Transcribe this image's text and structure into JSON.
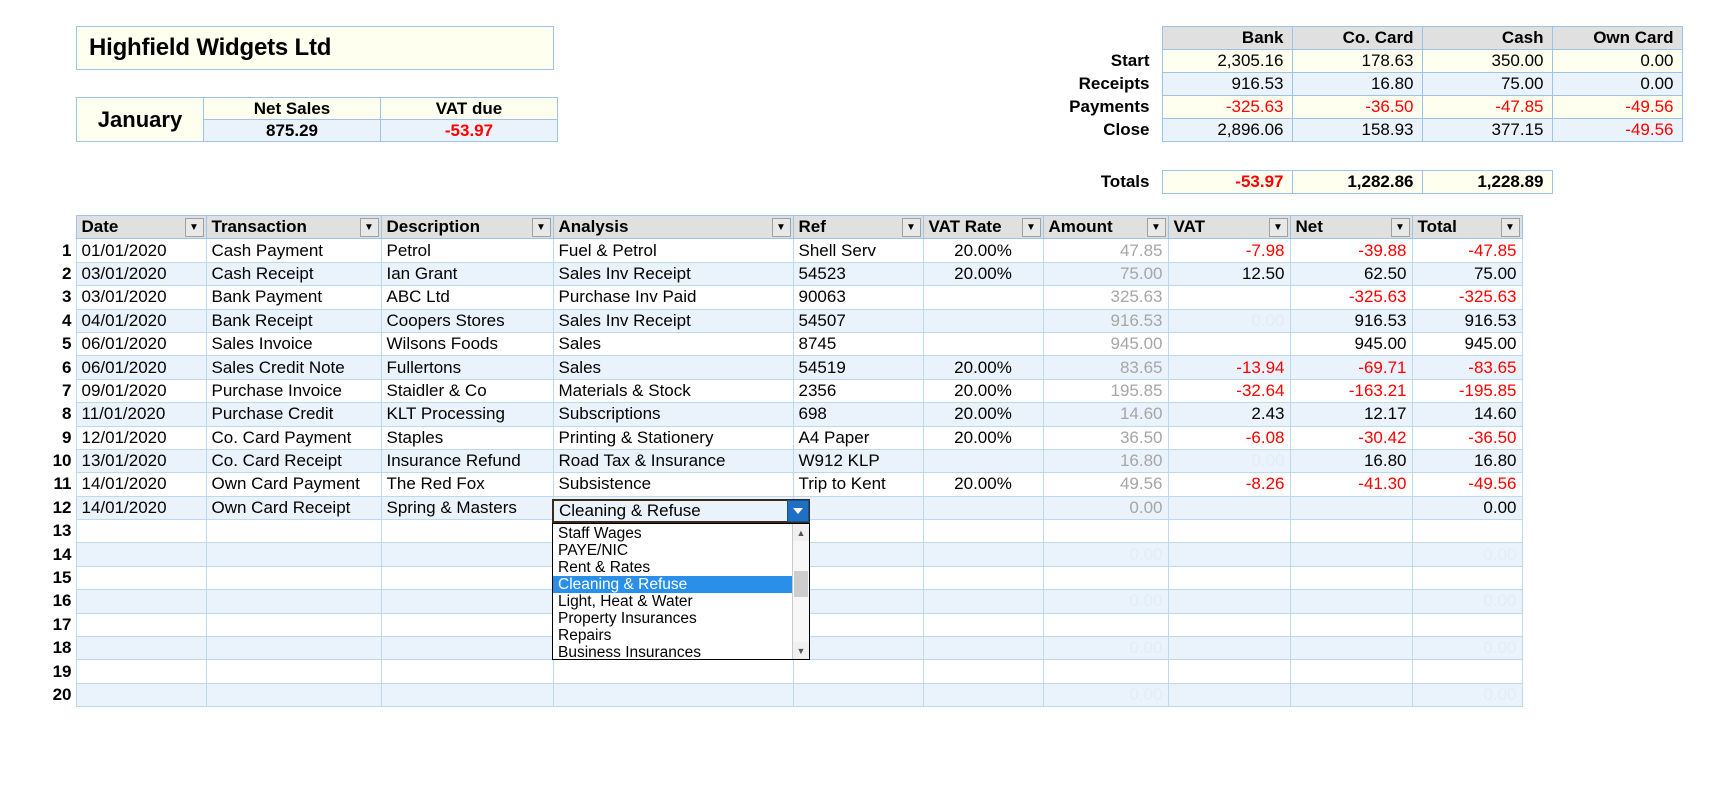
{
  "company": {
    "name": "Highfield Widgets Ltd"
  },
  "month_panel": {
    "month": "January",
    "headers": [
      "Net Sales",
      "VAT due"
    ],
    "net_sales": "875.29",
    "vat_due": "-53.97"
  },
  "summary": {
    "columns": [
      "Bank",
      "Co. Card",
      "Cash",
      "Own Card"
    ],
    "rows": [
      {
        "label": "Start",
        "values": [
          "2,305.16",
          "178.63",
          "350.00",
          "0.00"
        ]
      },
      {
        "label": "Receipts",
        "values": [
          "916.53",
          "16.80",
          "75.00",
          "0.00"
        ]
      },
      {
        "label": "Payments",
        "values": [
          "-325.63",
          "-36.50",
          "-47.85",
          "-49.56"
        ]
      },
      {
        "label": "Close",
        "values": [
          "2,896.06",
          "158.93",
          "377.15",
          "-49.56"
        ]
      }
    ]
  },
  "totals": {
    "label": "Totals",
    "values": [
      "-53.97",
      "1,282.86",
      "1,228.89"
    ]
  },
  "grid": {
    "headers": [
      "Date",
      "Transaction",
      "Description",
      "Analysis",
      "Ref",
      "VAT Rate",
      "Amount",
      "VAT",
      "Net",
      "Total"
    ],
    "rows": [
      {
        "n": "1",
        "date": "01/01/2020",
        "transaction": "Cash Payment",
        "description": "Petrol",
        "analysis": "Fuel & Petrol",
        "ref": "Shell Serv",
        "rate": "20.00%",
        "amount": "47.85",
        "vat": "-7.98",
        "net": "-39.88",
        "total": "-47.85"
      },
      {
        "n": "2",
        "date": "03/01/2020",
        "transaction": "Cash Receipt",
        "description": "Ian Grant",
        "analysis": "Sales Inv Receipt",
        "ref": "54523",
        "rate": "20.00%",
        "amount": "75.00",
        "vat": "12.50",
        "net": "62.50",
        "total": "75.00"
      },
      {
        "n": "3",
        "date": "03/01/2020",
        "transaction": "Bank Payment",
        "description": "ABC Ltd",
        "analysis": "Purchase Inv Paid",
        "ref": "90063",
        "rate": "",
        "amount": "325.63",
        "vat": "",
        "net": "-325.63",
        "total": "-325.63"
      },
      {
        "n": "4",
        "date": "04/01/2020",
        "transaction": "Bank Receipt",
        "description": "Coopers Stores",
        "analysis": "Sales Inv Receipt",
        "ref": "54507",
        "rate": "",
        "amount": "916.53",
        "vat": "0.00",
        "net": "916.53",
        "total": "916.53"
      },
      {
        "n": "5",
        "date": "06/01/2020",
        "transaction": "Sales Invoice",
        "description": "Wilsons Foods",
        "analysis": "Sales",
        "ref": "8745",
        "rate": "",
        "amount": "945.00",
        "vat": "",
        "net": "945.00",
        "total": "945.00"
      },
      {
        "n": "6",
        "date": "06/01/2020",
        "transaction": "Sales Credit Note",
        "description": "Fullertons",
        "analysis": "Sales",
        "ref": "54519",
        "rate": "20.00%",
        "amount": "83.65",
        "vat": "-13.94",
        "net": "-69.71",
        "total": "-83.65"
      },
      {
        "n": "7",
        "date": "09/01/2020",
        "transaction": "Purchase Invoice",
        "description": "Staidler & Co",
        "analysis": "Materials & Stock",
        "ref": "2356",
        "rate": "20.00%",
        "amount": "195.85",
        "vat": "-32.64",
        "net": "-163.21",
        "total": "-195.85"
      },
      {
        "n": "8",
        "date": "11/01/2020",
        "transaction": "Purchase Credit",
        "description": "KLT Processing",
        "analysis": "Subscriptions",
        "ref": "698",
        "rate": "20.00%",
        "amount": "14.60",
        "vat": "2.43",
        "net": "12.17",
        "total": "14.60"
      },
      {
        "n": "9",
        "date": "12/01/2020",
        "transaction": "Co. Card Payment",
        "description": "Staples",
        "analysis": "Printing & Stationery",
        "ref": "A4 Paper",
        "rate": "20.00%",
        "amount": "36.50",
        "vat": "-6.08",
        "net": "-30.42",
        "total": "-36.50"
      },
      {
        "n": "10",
        "date": "13/01/2020",
        "transaction": "Co. Card Receipt",
        "description": "Insurance Refund",
        "analysis": "Road Tax & Insurance",
        "ref": "W912 KLP",
        "rate": "",
        "amount": "16.80",
        "vat": "0.00",
        "net": "16.80",
        "total": "16.80"
      },
      {
        "n": "11",
        "date": "14/01/2020",
        "transaction": "Own Card Payment",
        "description": "The Red Fox",
        "analysis": "Subsistence",
        "ref": "Trip to Kent",
        "rate": "20.00%",
        "amount": "49.56",
        "vat": "-8.26",
        "net": "-41.30",
        "total": "-49.56"
      },
      {
        "n": "12",
        "date": "14/01/2020",
        "transaction": "Own Card Receipt",
        "description": "Spring & Masters",
        "analysis": "Cleaning & Refuse",
        "ref": "",
        "rate": "",
        "amount": "0.00",
        "vat": "",
        "net": "",
        "total": "0.00"
      },
      {
        "n": "13",
        "date": "",
        "transaction": "",
        "description": "",
        "analysis": "",
        "ref": "",
        "rate": "",
        "amount": "",
        "vat": "",
        "net": "",
        "total": ""
      },
      {
        "n": "14",
        "date": "",
        "transaction": "",
        "description": "",
        "analysis": "",
        "ref": "",
        "rate": "",
        "amount": "0.00",
        "vat": "",
        "net": "",
        "total": "0.00"
      },
      {
        "n": "15",
        "date": "",
        "transaction": "",
        "description": "",
        "analysis": "",
        "ref": "",
        "rate": "",
        "amount": "",
        "vat": "",
        "net": "",
        "total": ""
      },
      {
        "n": "16",
        "date": "",
        "transaction": "",
        "description": "",
        "analysis": "",
        "ref": "",
        "rate": "",
        "amount": "0.00",
        "vat": "",
        "net": "",
        "total": "0.00"
      },
      {
        "n": "17",
        "date": "",
        "transaction": "",
        "description": "",
        "analysis": "",
        "ref": "",
        "rate": "",
        "amount": "",
        "vat": "",
        "net": "",
        "total": ""
      },
      {
        "n": "18",
        "date": "",
        "transaction": "",
        "description": "",
        "analysis": "",
        "ref": "",
        "rate": "",
        "amount": "0.00",
        "vat": "",
        "net": "",
        "total": "0.00"
      },
      {
        "n": "19",
        "date": "",
        "transaction": "",
        "description": "",
        "analysis": "",
        "ref": "",
        "rate": "",
        "amount": "",
        "vat": "",
        "net": "",
        "total": ""
      },
      {
        "n": "20",
        "date": "",
        "transaction": "",
        "description": "",
        "analysis": "",
        "ref": "",
        "rate": "",
        "amount": "0.00",
        "vat": "",
        "net": "",
        "total": "0.00"
      }
    ]
  },
  "active_cell": {
    "value": "Cleaning & Refuse"
  },
  "dropdown": {
    "options": [
      "Staff Wages",
      "PAYE/NIC",
      "Rent & Rates",
      "Cleaning & Refuse",
      "Light, Heat & Water",
      "Property Insurances",
      "Repairs",
      "Business Insurances"
    ],
    "selected": "Cleaning & Refuse",
    "scroll_up_icon": "▲",
    "scroll_down_icon": "▼"
  },
  "colors": {
    "negative": "#ff0000",
    "header_grey": "#e0e0e0",
    "cream": "#fffff0",
    "band": "#eaf3fb",
    "grid_line": "#bcd9f0",
    "select_blue": "#2a8fe8"
  }
}
